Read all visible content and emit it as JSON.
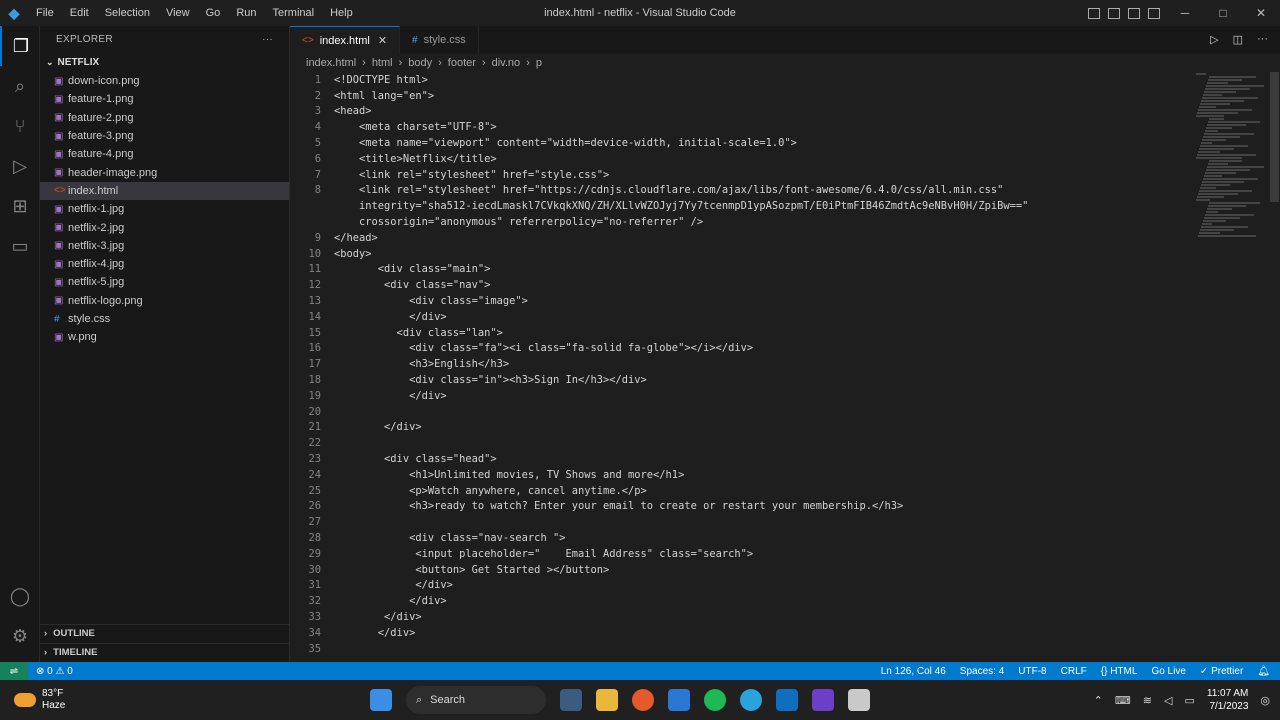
{
  "titlebar": {
    "menu": [
      "File",
      "Edit",
      "Selection",
      "View",
      "Go",
      "Run",
      "Terminal",
      "Help"
    ],
    "title": "index.html - netflix - Visual Studio Code"
  },
  "sidebar": {
    "title": "EXPLORER",
    "more": "···",
    "project": "NETFLIX",
    "files": [
      {
        "name": "down-icon.png",
        "type": "img"
      },
      {
        "name": "feature-1.png",
        "type": "img"
      },
      {
        "name": "feature-2.png",
        "type": "img"
      },
      {
        "name": "feature-3.png",
        "type": "img"
      },
      {
        "name": "feature-4.png",
        "type": "img"
      },
      {
        "name": "header-image.png",
        "type": "img"
      },
      {
        "name": "index.html",
        "type": "html",
        "selected": true
      },
      {
        "name": "netflix-1.jpg",
        "type": "img"
      },
      {
        "name": "netflix-2.jpg",
        "type": "img"
      },
      {
        "name": "netflix-3.jpg",
        "type": "img"
      },
      {
        "name": "netflix-4.jpg",
        "type": "img"
      },
      {
        "name": "netflix-5.jpg",
        "type": "img"
      },
      {
        "name": "netflix-logo.png",
        "type": "img"
      },
      {
        "name": "style.css",
        "type": "css"
      },
      {
        "name": "w.png",
        "type": "img"
      }
    ],
    "outline": "OUTLINE",
    "timeline": "TIMELINE"
  },
  "tabs": [
    {
      "label": "index.html",
      "active": true,
      "icon": "<>"
    },
    {
      "label": "style.css",
      "active": false,
      "icon": "#"
    }
  ],
  "breadcrumb": [
    "index.html",
    "html",
    "body",
    "footer",
    "div.no",
    "p"
  ],
  "code": [
    {
      "n": "1",
      "t": "<!DOCTYPE html>"
    },
    {
      "n": "2",
      "t": "<html lang=\"en\">"
    },
    {
      "n": "3",
      "t": "<head>"
    },
    {
      "n": "4",
      "t": "    <meta charset=\"UTF-8\">"
    },
    {
      "n": "5",
      "t": "    <meta name=\"viewport\" content=\"width=device-width, initial-scale=1.0\">"
    },
    {
      "n": "6",
      "t": "    <title>Netflix</title>"
    },
    {
      "n": "7",
      "t": "    <link rel=\"stylesheet\" href=\"style.css\">"
    },
    {
      "n": "8",
      "t": "    <link rel=\"stylesheet\" href=\"https://cdnjs.cloudflare.com/ajax/libs/font-awesome/6.4.0/css/all.min.css\""
    },
    {
      "n": "",
      "t": "    integrity=\"sha512-iecdLmaskl7CVkqkXNQ/ZH/XLlvWZOJyj7Yy7tcenmpD1ypASozpmT/E0iPtmFIB46ZmdtAc9eNBvH0H/ZpiBw==\""
    },
    {
      "n": "",
      "t": "    crossorigin=\"anonymous\" referrerpolicy=\"no-referrer\" />"
    },
    {
      "n": "9",
      "t": "</head>"
    },
    {
      "n": "10",
      "t": "<body>"
    },
    {
      "n": "11",
      "t": "       <div class=\"main\">"
    },
    {
      "n": "12",
      "t": "        <div class=\"nav\">"
    },
    {
      "n": "13",
      "t": "            <div class=\"image\">"
    },
    {
      "n": "14",
      "t": "            </div>"
    },
    {
      "n": "15",
      "t": "          <div class=\"lan\">"
    },
    {
      "n": "16",
      "t": "            <div class=\"fa\"><i class=\"fa-solid fa-globe\"></i></div>"
    },
    {
      "n": "17",
      "t": "            <h3>English</h3>"
    },
    {
      "n": "18",
      "t": "            <div class=\"in\"><h3>Sign In</h3></div>"
    },
    {
      "n": "19",
      "t": "            </div>"
    },
    {
      "n": "20",
      "t": ""
    },
    {
      "n": "21",
      "t": "        </div>"
    },
    {
      "n": "22",
      "t": ""
    },
    {
      "n": "23",
      "t": "        <div class=\"head\">"
    },
    {
      "n": "24",
      "t": "            <h1>Unlimited movies, TV Shows and more</h1>"
    },
    {
      "n": "25",
      "t": "            <p>Watch anywhere, cancel anytime.</p>"
    },
    {
      "n": "26",
      "t": "            <h3>ready to watch? Enter your email to create or restart your membership.</h3>"
    },
    {
      "n": "27",
      "t": ""
    },
    {
      "n": "28",
      "t": "            <div class=\"nav-search \">"
    },
    {
      "n": "29",
      "t": "             <input placeholder=\"    Email Address\" class=\"search\">"
    },
    {
      "n": "30",
      "t": "             <button> Get Started ></button>"
    },
    {
      "n": "31",
      "t": "             </div>"
    },
    {
      "n": "32",
      "t": "            </div>"
    },
    {
      "n": "33",
      "t": "        </div>"
    },
    {
      "n": "34",
      "t": "       </div>"
    },
    {
      "n": "35",
      "t": ""
    }
  ],
  "status": {
    "errors": "⊗ 0 ⚠ 0",
    "position": "Ln 126, Col 46",
    "spaces": "Spaces: 4",
    "encoding": "UTF-8",
    "eol": "CRLF",
    "language": "{} HTML",
    "golive": "Go Live",
    "prettier": "✓ Prettier"
  },
  "taskbar": {
    "temp": "83°F",
    "weather": "Haze",
    "search": "Search",
    "time": "11:07 AM",
    "date": "7/1/2023"
  },
  "colors": {
    "accent": "#007acc",
    "selection": "#37373d",
    "tag": "#569cd6",
    "string": "#ce9178",
    "attr": "#9cdcfe"
  }
}
